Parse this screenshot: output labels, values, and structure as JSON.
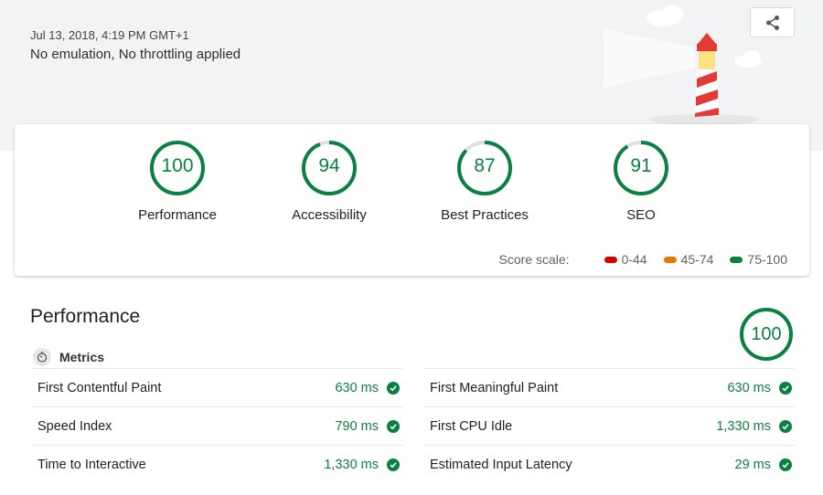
{
  "header": {
    "run_date": "Jul 13, 2018, 4:19 PM GMT+1",
    "environment": "No emulation, No throttling applied",
    "share_icon": "share-icon"
  },
  "scores": [
    {
      "label": "Performance",
      "value": "100",
      "score": 1.0
    },
    {
      "label": "Accessibility",
      "value": "94",
      "score": 0.94
    },
    {
      "label": "Best Practices",
      "value": "87",
      "score": 0.87
    },
    {
      "label": "SEO",
      "value": "91",
      "score": 0.91
    }
  ],
  "score_scale": {
    "label": "Score scale:",
    "items": [
      {
        "range": "0-44",
        "color": "#d50000"
      },
      {
        "range": "45-74",
        "color": "#e67700"
      },
      {
        "range": "75-100",
        "color": "#0b8043"
      }
    ]
  },
  "colors": {
    "pass": "#0b8043",
    "track": "#e0e0e0"
  },
  "performance": {
    "title": "Performance",
    "score": "100",
    "metrics_label": "Metrics",
    "metrics": [
      {
        "name": "First Contentful Paint",
        "value": "630 ms"
      },
      {
        "name": "First Meaningful Paint",
        "value": "630 ms"
      },
      {
        "name": "Speed Index",
        "value": "790 ms"
      },
      {
        "name": "First CPU Idle",
        "value": "1,330 ms"
      },
      {
        "name": "Time to Interactive",
        "value": "1,330 ms"
      },
      {
        "name": "Estimated Input Latency",
        "value": "29 ms"
      }
    ]
  }
}
